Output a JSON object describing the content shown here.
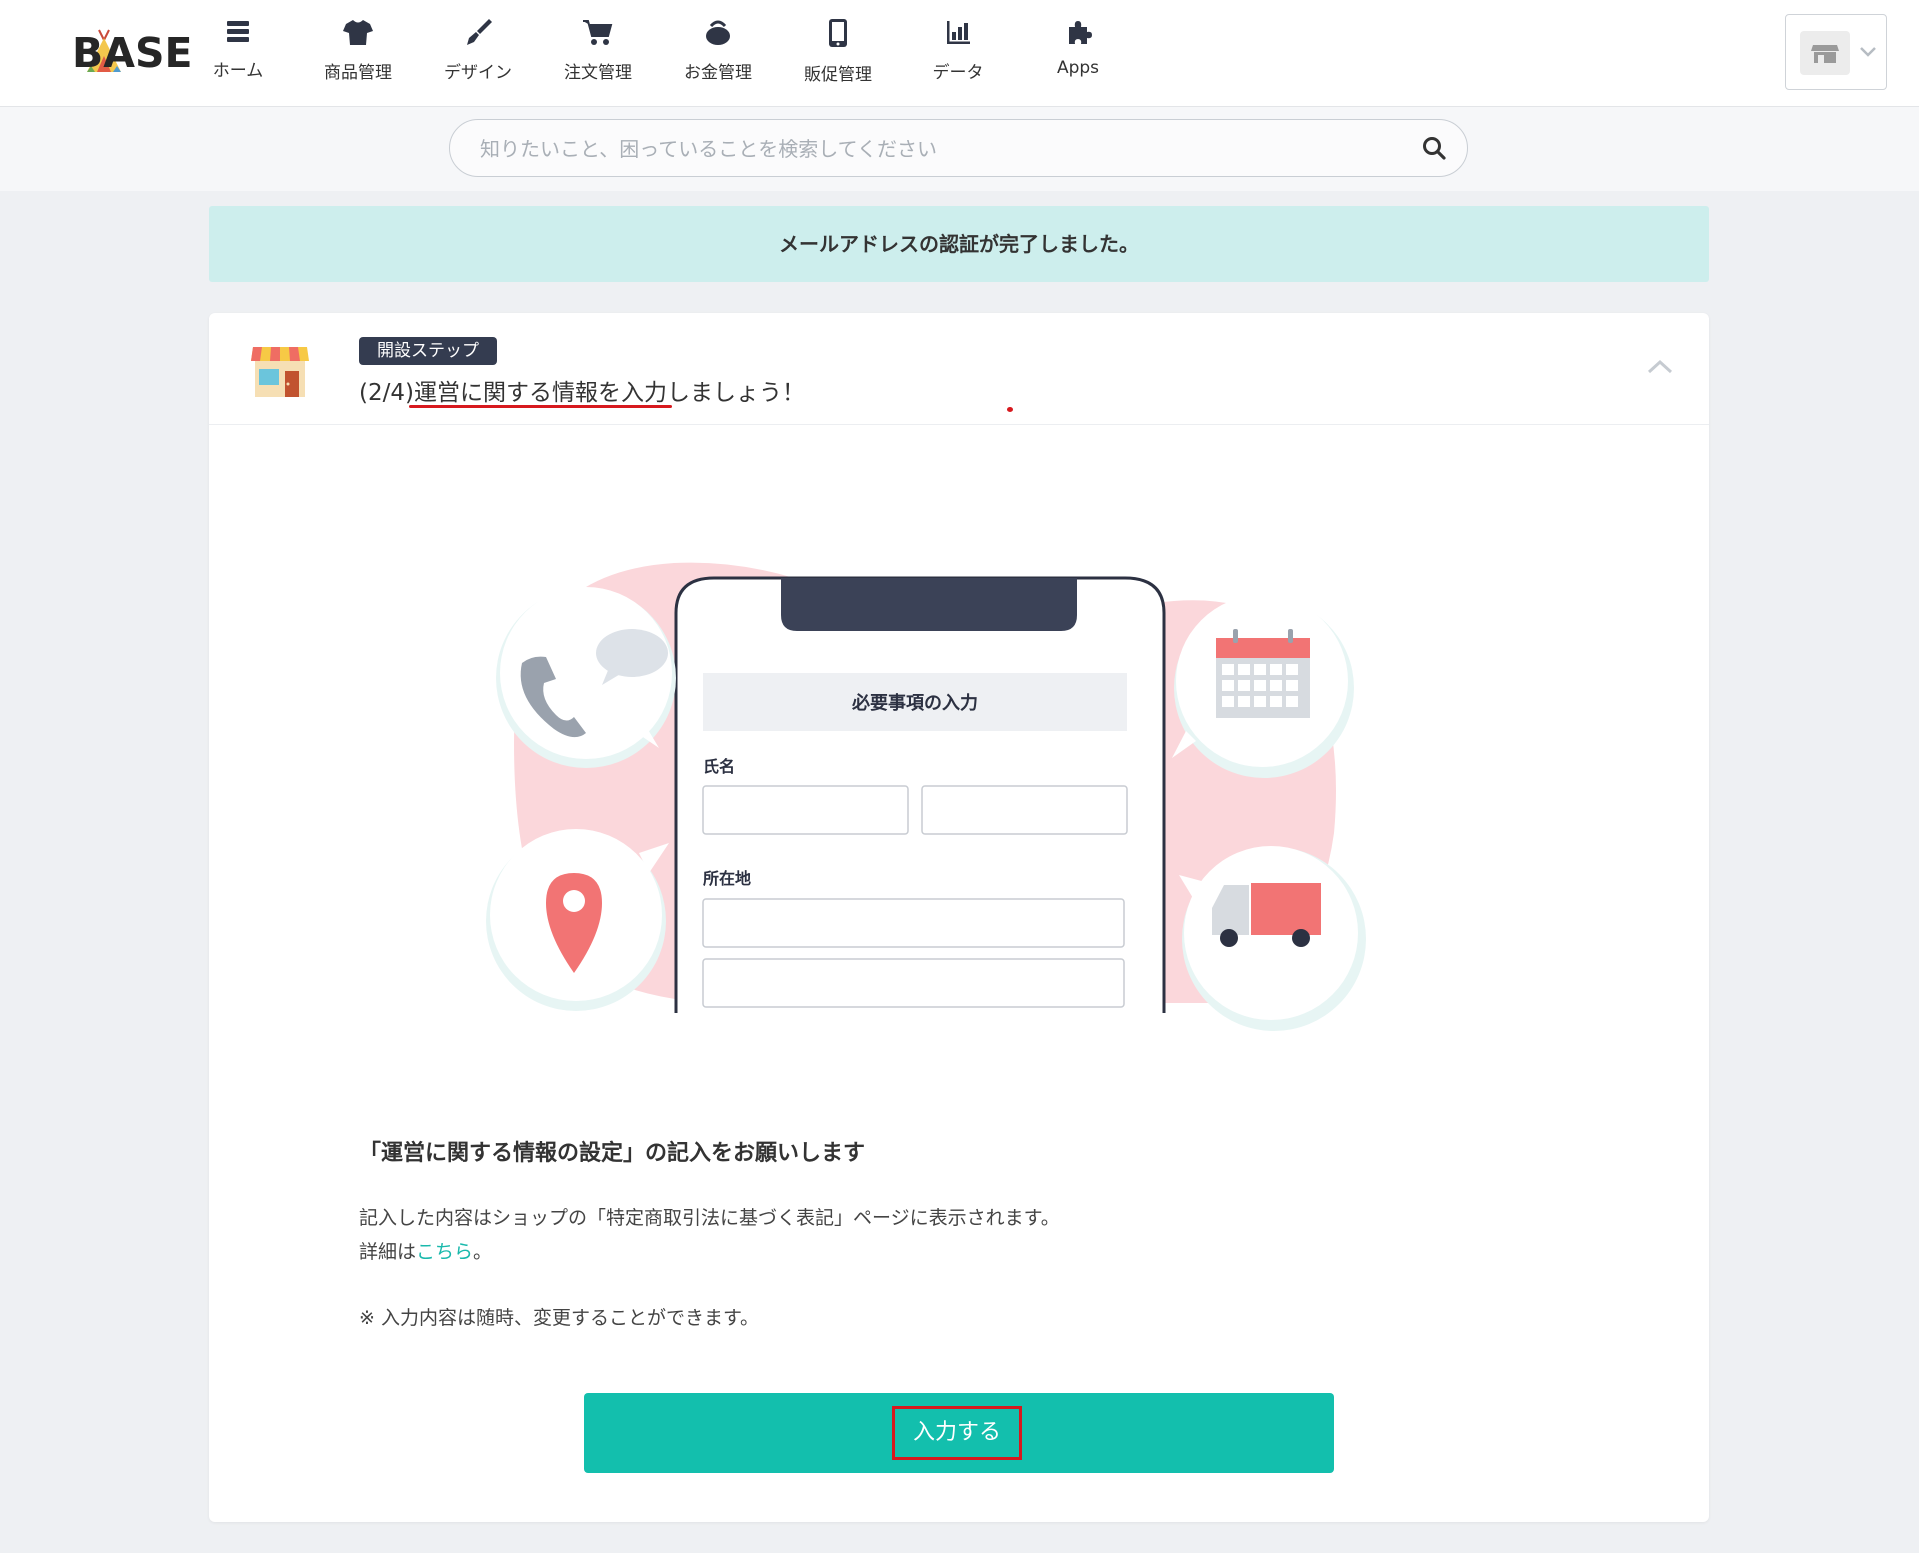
{
  "brand": {
    "name": "BASE"
  },
  "nav": {
    "items": [
      {
        "label": "ホーム",
        "icon": "list-icon"
      },
      {
        "label": "商品管理",
        "icon": "tshirt-icon"
      },
      {
        "label": "デザイン",
        "icon": "brush-icon"
      },
      {
        "label": "注文管理",
        "icon": "cart-icon"
      },
      {
        "label": "お金管理",
        "icon": "coin-purse-icon"
      },
      {
        "label": "販促管理",
        "icon": "smartphone-icon"
      },
      {
        "label": "データ",
        "icon": "bar-chart-icon"
      },
      {
        "label": "Apps",
        "icon": "puzzle-icon"
      }
    ]
  },
  "shop_switcher": {
    "icon": "store-icon"
  },
  "search": {
    "placeholder": "知りたいこと、困っていることを検索してください"
  },
  "notice": {
    "text": "メールアドレスの認証が完了しました。"
  },
  "setup": {
    "badge": "開設ステップ",
    "step": "(2/4)",
    "title": "運営に関する情報を入力しましょう！"
  },
  "illustration": {
    "form_heading": "必要事項の入力",
    "name_label": "氏名",
    "address_label": "所在地"
  },
  "content": {
    "heading": "「運営に関する情報の設定」の記入をお願いします",
    "paragraph1": "記入した内容はショップの「特定商取引法に基づく表記」ページに表示されます。",
    "details_prefix": "詳細は",
    "details_link": "こちら",
    "details_suffix": "。",
    "note": "※ 入力内容は随時、変更することができます。"
  },
  "cta": {
    "label": "入力する"
  },
  "colors": {
    "accent": "#13bfad",
    "notice_bg": "#cdeeed",
    "badge_bg": "#343c50",
    "highlight_red": "#d7191e",
    "link": "#1ab9ac"
  }
}
